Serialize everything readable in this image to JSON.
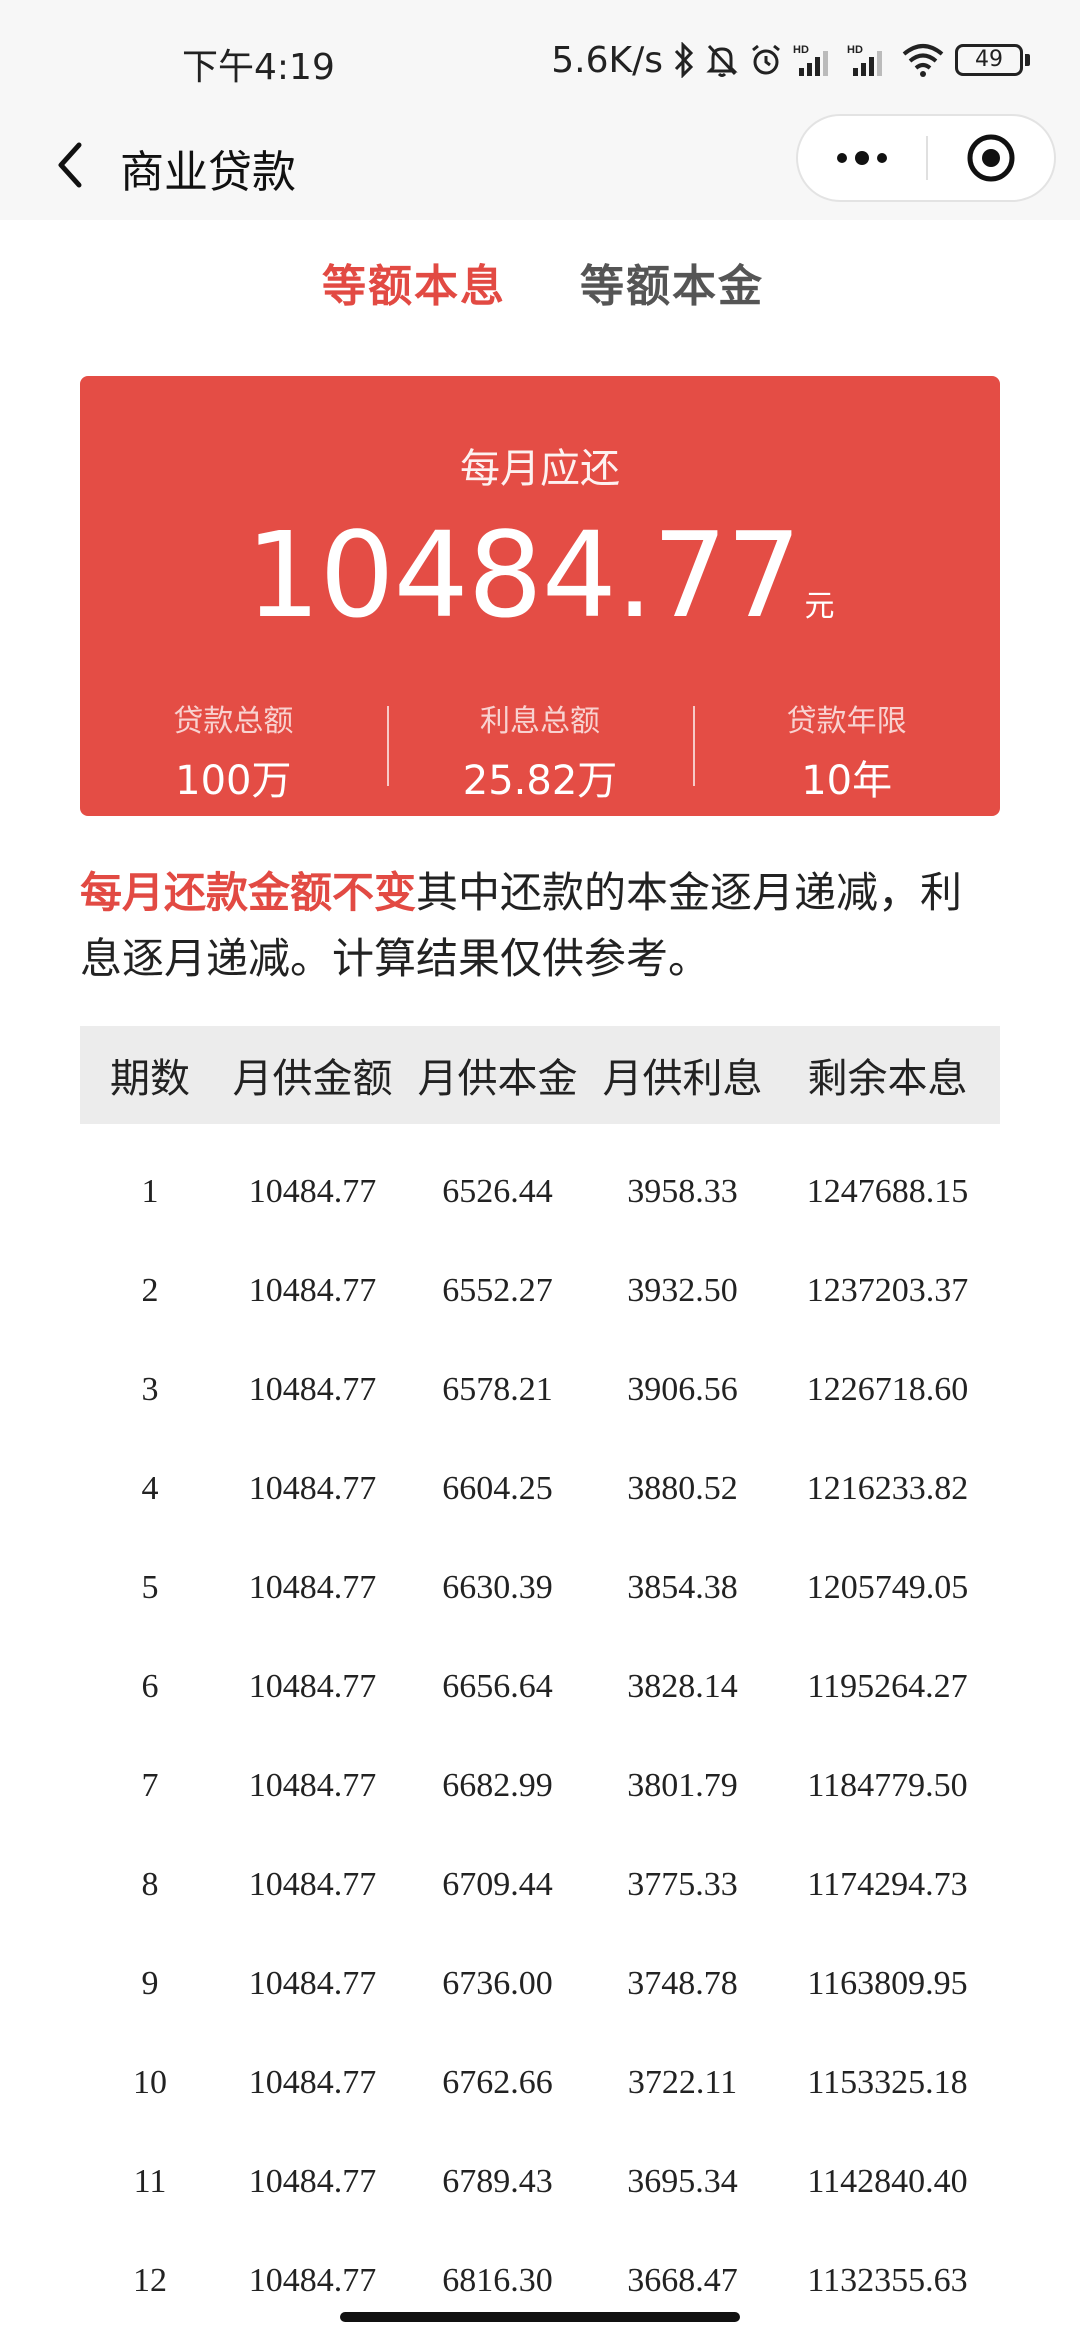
{
  "status_bar": {
    "time": "下午4:19",
    "network_speed": "5.6K/s",
    "battery": "49",
    "icons": [
      "bluetooth-icon",
      "mute-icon",
      "alarm-icon",
      "signal-hd-icon",
      "signal-hd-icon",
      "wifi-icon",
      "battery-icon"
    ]
  },
  "nav": {
    "title": "商业贷款",
    "back_icon": "chevron-left-icon",
    "more_icon": "more-dots-icon",
    "close_icon": "target-close-icon"
  },
  "tabs": [
    {
      "label": "等额本息",
      "active": true
    },
    {
      "label": "等额本金",
      "active": false
    }
  ],
  "summary": {
    "label": "每月应还",
    "amount": "10484.77",
    "unit": "元",
    "stats": [
      {
        "label": "贷款总额",
        "value": "100万"
      },
      {
        "label": "利息总额",
        "value": "25.82万"
      },
      {
        "label": "贷款年限",
        "value": "10年"
      }
    ]
  },
  "note": {
    "highlight": "每月还款金额不变",
    "rest": "其中还款的本金逐月递减，利息逐月递减。计算结果仅供参考。"
  },
  "table": {
    "headers": [
      "期数",
      "月供金额",
      "月供本金",
      "月供利息",
      "剩余本息"
    ],
    "rows": [
      [
        "1",
        "10484.77",
        "6526.44",
        "3958.33",
        "1247688.15"
      ],
      [
        "2",
        "10484.77",
        "6552.27",
        "3932.50",
        "1237203.37"
      ],
      [
        "3",
        "10484.77",
        "6578.21",
        "3906.56",
        "1226718.60"
      ],
      [
        "4",
        "10484.77",
        "6604.25",
        "3880.52",
        "1216233.82"
      ],
      [
        "5",
        "10484.77",
        "6630.39",
        "3854.38",
        "1205749.05"
      ],
      [
        "6",
        "10484.77",
        "6656.64",
        "3828.14",
        "1195264.27"
      ],
      [
        "7",
        "10484.77",
        "6682.99",
        "3801.79",
        "1184779.50"
      ],
      [
        "8",
        "10484.77",
        "6709.44",
        "3775.33",
        "1174294.73"
      ],
      [
        "9",
        "10484.77",
        "6736.00",
        "3748.78",
        "1163809.95"
      ],
      [
        "10",
        "10484.77",
        "6762.66",
        "3722.11",
        "1153325.18"
      ],
      [
        "11",
        "10484.77",
        "6789.43",
        "3695.34",
        "1142840.40"
      ],
      [
        "12",
        "10484.77",
        "6816.30",
        "3668.47",
        "1132355.63"
      ]
    ]
  },
  "colors": {
    "accent": "#e24a43",
    "card": "#e44d45",
    "header_bg": "#ececec"
  }
}
